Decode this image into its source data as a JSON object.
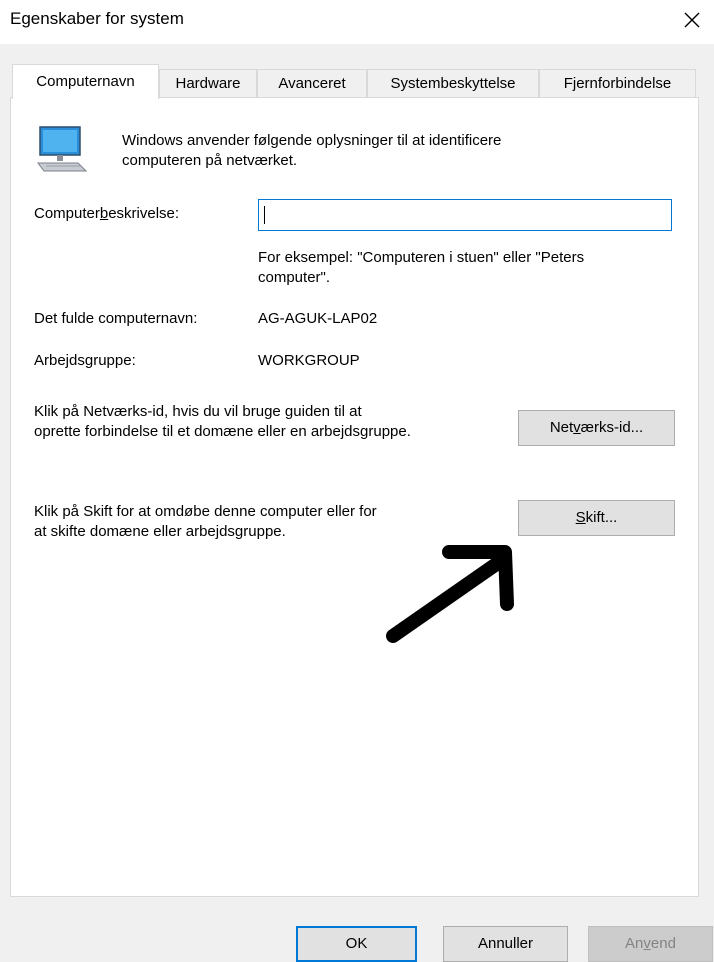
{
  "window": {
    "title": "Egenskaber for system",
    "close_icon": "close-icon"
  },
  "tabs": [
    {
      "label": "Computernavn",
      "active": true
    },
    {
      "label": "Hardware",
      "active": false
    },
    {
      "label": "Avanceret",
      "active": false
    },
    {
      "label": "Systembeskyttelse",
      "active": false
    },
    {
      "label": "Fjernforbindelse",
      "active": false
    }
  ],
  "panel": {
    "intro_line1": "Windows anvender følgende oplysninger til at identificere",
    "intro_line2": "computeren på netværket.",
    "computer_icon": "computer-monitor-icon",
    "description_label_pre": "Computer",
    "description_label_accel": "b",
    "description_label_post": "eskrivelse:",
    "description_value": "",
    "example_line1": "For eksempel: \"Computeren i stuen\" eller \"Peters",
    "example_line2": "computer\".",
    "fullname_label": "Det fulde computernavn:",
    "fullname_value": "AG-AGUK-LAP02",
    "workgroup_label": "Arbejdsgruppe:",
    "workgroup_value": "WORKGROUP",
    "network_text_line1": "Klik på Netværks-id, hvis du vil bruge guiden til at",
    "network_text_line2": "oprette forbindelse til et domæne eller en arbejdsgruppe.",
    "network_button_pre": "Net",
    "network_button_accel": "v",
    "network_button_post": "ærks-id...",
    "change_text_line1": "Klik på Skift for at omdøbe denne computer eller for",
    "change_text_line2": "at skifte domæne eller arbejdsgruppe.",
    "change_button_accel": "S",
    "change_button_post": "kift..."
  },
  "annotation": {
    "arrow_icon": "arrow-icon"
  },
  "footer": {
    "ok_label": "OK",
    "cancel_label": "Annuller",
    "apply_pre": "An",
    "apply_accel": "v",
    "apply_post": "end"
  },
  "colors": {
    "accent": "#0078d7",
    "dialog_bg": "#f0f0f0",
    "panel_bg": "#ffffff",
    "button_bg": "#e1e1e1",
    "disabled_text": "#838383"
  }
}
